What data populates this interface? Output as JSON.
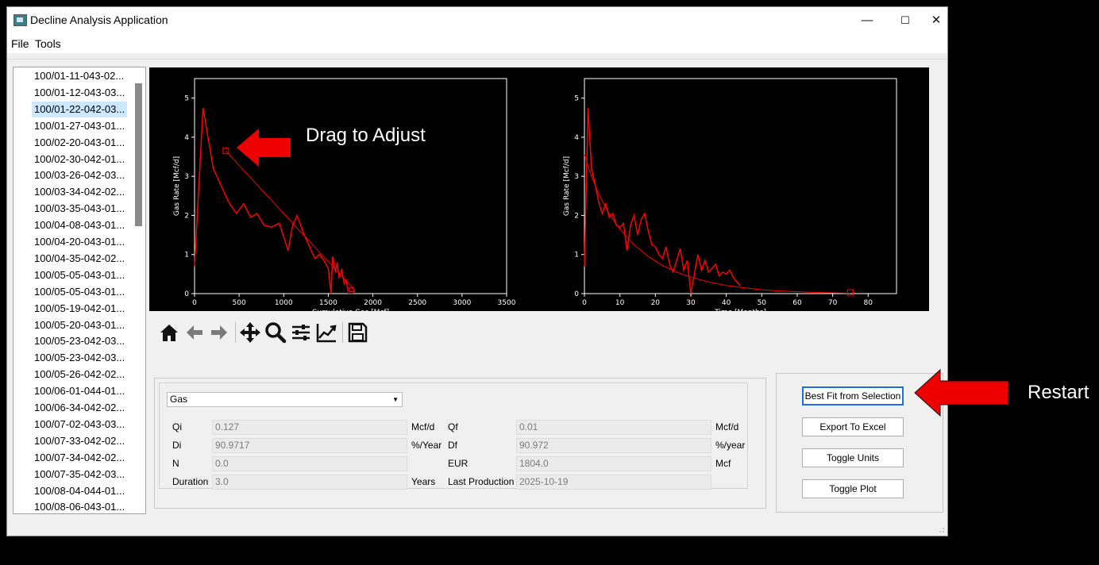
{
  "window": {
    "title": "Decline Analysis Application",
    "minimize": "—",
    "maximize": "☐",
    "close": "✕"
  },
  "menu": [
    "File",
    "Tools"
  ],
  "wells": [
    "100/01-11-043-02...",
    "100/01-12-043-03...",
    "100/01-22-042-03...",
    "100/01-27-043-01...",
    "100/02-20-043-01...",
    "100/02-30-042-01...",
    "100/03-26-042-03...",
    "100/03-34-042-02...",
    "100/03-35-043-01...",
    "100/04-08-043-01...",
    "100/04-20-043-01...",
    "100/04-35-042-02...",
    "100/05-05-043-01...",
    "100/05-05-043-01...",
    "100/05-19-042-01...",
    "100/05-20-043-01...",
    "100/05-23-042-03...",
    "100/05-23-042-03...",
    "100/05-26-042-02...",
    "100/06-01-044-01...",
    "100/06-34-042-02...",
    "100/07-02-043-03...",
    "100/07-33-042-02...",
    "100/07-34-042-02...",
    "100/07-35-042-03...",
    "100/08-04-044-01...",
    "100/08-06-043-01..."
  ],
  "selected_well_index": 2,
  "toolbar_icons": [
    "home-icon",
    "back-arrow-icon",
    "forward-arrow-icon",
    "pan-icon",
    "zoom-icon",
    "configure-subplots-icon",
    "edit-axes-icon",
    "save-icon"
  ],
  "form": {
    "product": "Gas",
    "qi_label": "Qi",
    "qi_value": "0.127",
    "qi_unit": "Mcf/d",
    "di_label": "Di",
    "di_value": "90.9717",
    "di_unit": "%/Year",
    "n_label": "N",
    "n_value": "0.0",
    "duration_label": "Duration",
    "duration_value": "3.0",
    "duration_unit": "Years",
    "qf_label": "Qf",
    "qf_value": "0.01",
    "qf_unit": "Mcf/d",
    "df_label": "Df",
    "df_value": "90.972",
    "df_unit": "%/year",
    "eur_label": "EUR",
    "eur_value": "1804.0",
    "eur_unit": "Mcf",
    "last_prod_label": "Last Production",
    "last_prod_value": "2025-10-19"
  },
  "buttons": {
    "best_fit": "Best Fit from Selection",
    "export": "Export To Excel",
    "toggle_units": "Toggle Units",
    "toggle_plot": "Toggle Plot"
  },
  "annotations": {
    "drag": "Drag to Adjust",
    "restart": "Restart"
  },
  "colors": {
    "series": "#ff0000",
    "arrow": "#ee0000",
    "selection": "#cce8ff",
    "focus": "#1e6fd9"
  },
  "chart_data": [
    {
      "type": "line",
      "xlabel": "Cumulative Gas [Mcf]",
      "ylabel": "Gas Rate [Mcf/d]",
      "xlim": [
        0,
        3500
      ],
      "ylim": [
        0,
        5.5
      ],
      "xticks": [
        "0",
        "500",
        "1000",
        "1500",
        "2000",
        "2500",
        "3000",
        "3500"
      ],
      "yticks": [
        "0",
        "1",
        "2",
        "3",
        "4",
        "5"
      ],
      "series": [
        {
          "x": [
            0,
            95,
            210,
            290,
            380,
            470,
            550,
            630,
            700,
            780,
            860,
            950,
            1050,
            1100,
            1150,
            1230,
            1290,
            1350,
            1400,
            1450,
            1500,
            1530,
            1550,
            1580,
            1600,
            1620,
            1650,
            1680,
            1700,
            1720,
            1750,
            1800
          ],
          "y": [
            0.7,
            4.75,
            3.2,
            2.8,
            2.35,
            2.05,
            2.3,
            1.95,
            2.05,
            1.75,
            1.7,
            1.8,
            1.1,
            1.75,
            2.0,
            1.5,
            1.2,
            0.9,
            1.0,
            0.85,
            0.65,
            0.0,
            0.95,
            0.55,
            0.8,
            0.4,
            0.6,
            0.25,
            0.35,
            0.1,
            0.05,
            0.05
          ]
        },
        {
          "x": [
            350,
            1800
          ],
          "y": [
            3.65,
            0.08
          ]
        }
      ],
      "handles": [
        {
          "x": 350,
          "y": 3.65
        },
        {
          "x": 1750,
          "y": 0.08
        }
      ]
    },
    {
      "type": "line",
      "xlabel": "Time [Months]",
      "ylabel": "Gas Rate [Mcf/d]",
      "xlim": [
        0,
        88
      ],
      "ylim": [
        0,
        5.5
      ],
      "xticks": [
        "0",
        "10",
        "20",
        "30",
        "40",
        "50",
        "60",
        "70",
        "80"
      ],
      "yticks": [
        "0",
        "1",
        "2",
        "3",
        "4",
        "5"
      ],
      "series": [
        {
          "x": [
            0,
            1,
            2,
            3,
            4,
            5,
            6,
            7,
            8,
            9,
            10,
            11,
            12,
            13,
            14,
            15,
            16,
            17,
            18,
            19,
            20,
            21,
            22,
            23,
            24,
            25,
            26,
            27,
            28,
            29,
            30,
            31,
            32,
            33,
            34,
            35,
            36,
            37,
            38,
            39,
            40,
            41,
            42,
            43,
            44
          ],
          "y": [
            0.7,
            4.75,
            3.2,
            2.8,
            2.35,
            2.05,
            2.3,
            1.95,
            2.05,
            1.75,
            1.7,
            1.8,
            1.1,
            1.75,
            2.0,
            1.5,
            1.9,
            2.05,
            1.6,
            1.25,
            1.2,
            1.0,
            0.9,
            1.2,
            0.75,
            0.55,
            0.85,
            1.15,
            0.6,
            0.85,
            0.0,
            0.5,
            1.0,
            0.6,
            0.85,
            0.55,
            0.65,
            0.75,
            0.45,
            0.55,
            0.5,
            0.6,
            0.4,
            0.3,
            0.2
          ]
        },
        {
          "x": [
            0,
            2,
            4,
            6,
            8,
            10,
            14,
            18,
            22,
            26,
            30,
            35,
            40,
            45,
            50,
            55,
            60,
            65,
            70,
            75
          ],
          "y": [
            3.55,
            3.0,
            2.55,
            2.2,
            1.9,
            1.65,
            1.25,
            0.95,
            0.72,
            0.55,
            0.42,
            0.3,
            0.21,
            0.15,
            0.1,
            0.07,
            0.05,
            0.03,
            0.02,
            0.01
          ]
        }
      ],
      "handles": [
        {
          "x": 75,
          "y": 0.03
        }
      ]
    }
  ]
}
